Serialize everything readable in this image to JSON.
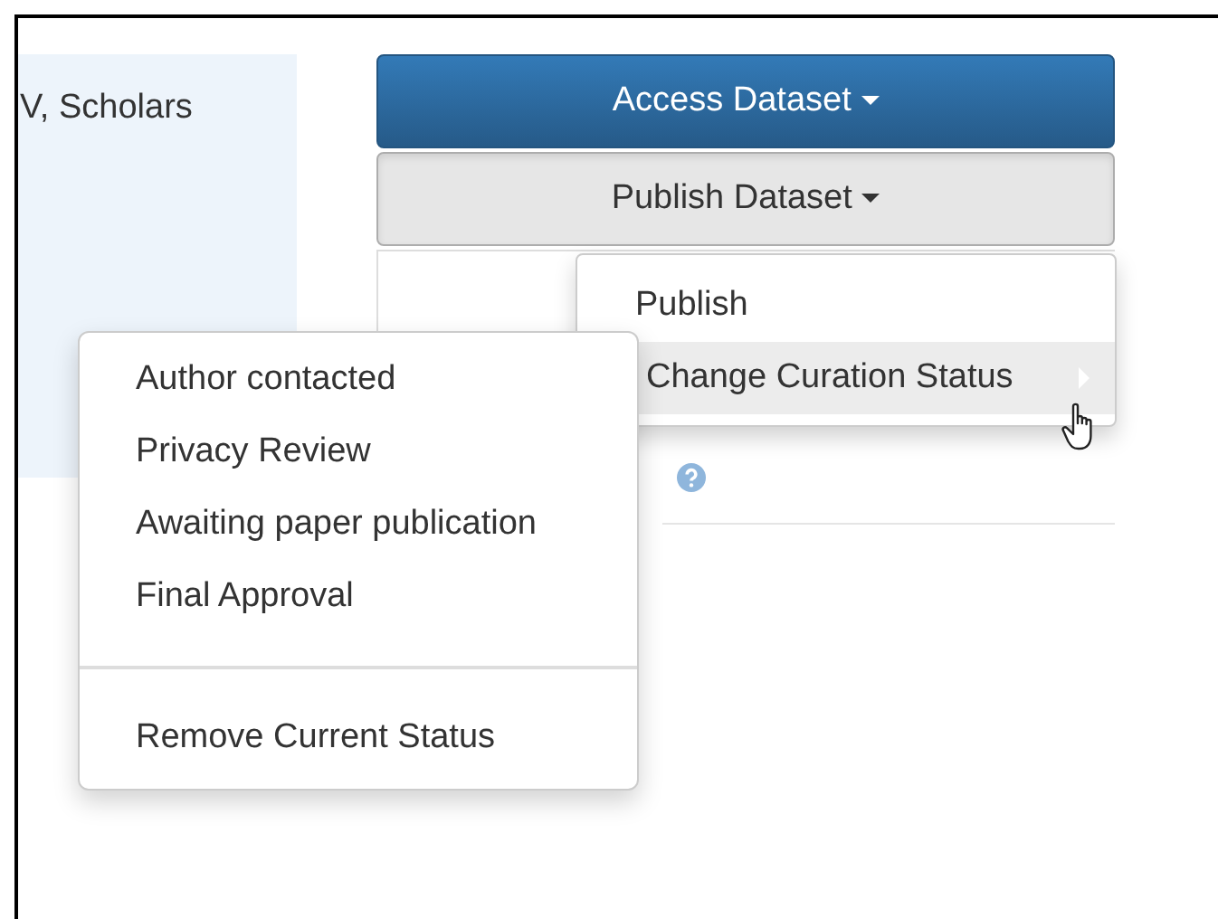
{
  "info_panel": {
    "text": "V, Scholars"
  },
  "buttons": [
    {
      "label": "Access Dataset",
      "kind": "primary"
    },
    {
      "label": "Publish Dataset",
      "kind": "default"
    }
  ],
  "publish_menu": {
    "items": [
      {
        "label": "Publish",
        "kind": "action",
        "selected": false
      },
      {
        "label": "Change Curation Status",
        "kind": "submenu",
        "selected": true
      }
    ]
  },
  "curation_menu": {
    "status_items": [
      {
        "label": "Author contacted"
      },
      {
        "label": "Privacy Review"
      },
      {
        "label": "Awaiting paper publication"
      },
      {
        "label": "Final Approval"
      }
    ],
    "footer_items": [
      {
        "label": "Remove Current Status"
      }
    ]
  }
}
